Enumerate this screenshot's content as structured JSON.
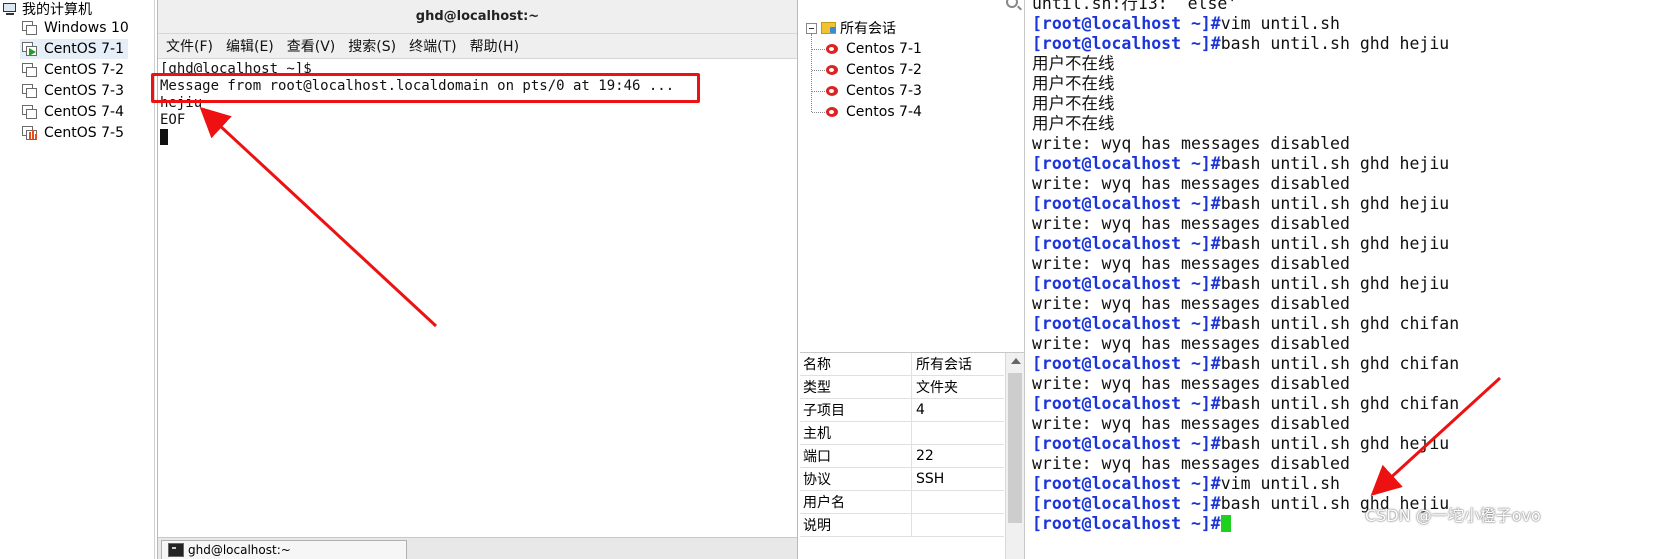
{
  "vm_tree": {
    "root_label": "我的计算机",
    "items": [
      {
        "label": "Windows 10",
        "state": "off"
      },
      {
        "label": "CentOS 7-1",
        "state": "running"
      },
      {
        "label": "CentOS 7-2",
        "state": "off"
      },
      {
        "label": "CentOS 7-3",
        "state": "off"
      },
      {
        "label": "CentOS 7-4",
        "state": "off"
      },
      {
        "label": "CentOS 7-5",
        "state": "suspended"
      }
    ]
  },
  "console": {
    "title": "ghd@localhost:~",
    "menu": [
      "文件(F)",
      "编辑(E)",
      "查看(V)",
      "搜索(S)",
      "终端(T)",
      "帮助(H)"
    ],
    "lines": [
      "[ghd@localhost ~]$",
      "Message from root@localhost.localdomain on pts/0 at 19:46 ...",
      "hejiu",
      "EOF"
    ],
    "taskbar_item": "ghd@localhost:~"
  },
  "sessions": {
    "root_label": "所有会话",
    "items": [
      "Centos 7-1",
      "Centos 7-2",
      "Centos 7-3",
      "Centos 7-4"
    ],
    "properties": [
      {
        "key": "名称",
        "value": "所有会话"
      },
      {
        "key": "类型",
        "value": "文件夹"
      },
      {
        "key": "子项目",
        "value": "4"
      },
      {
        "key": "主机",
        "value": ""
      },
      {
        "key": "端口",
        "value": "22"
      },
      {
        "key": "协议",
        "value": "SSH"
      },
      {
        "key": "用户名",
        "value": ""
      },
      {
        "key": "说明",
        "value": ""
      }
    ]
  },
  "shell": {
    "prompt": "[root@localhost ~]#",
    "lines": [
      {
        "prompt": false,
        "text": "until.sh:行13:  else'"
      },
      {
        "prompt": true,
        "text": "vim until.sh"
      },
      {
        "prompt": true,
        "text": "bash until.sh ghd hejiu"
      },
      {
        "prompt": false,
        "text": "用户不在线"
      },
      {
        "prompt": false,
        "text": "用户不在线"
      },
      {
        "prompt": false,
        "text": "用户不在线"
      },
      {
        "prompt": false,
        "text": "用户不在线"
      },
      {
        "prompt": false,
        "text": "write: wyq has messages disabled"
      },
      {
        "prompt": true,
        "text": "bash until.sh ghd hejiu"
      },
      {
        "prompt": false,
        "text": "write: wyq has messages disabled"
      },
      {
        "prompt": true,
        "text": "bash until.sh ghd hejiu"
      },
      {
        "prompt": false,
        "text": "write: wyq has messages disabled"
      },
      {
        "prompt": true,
        "text": "bash until.sh ghd hejiu"
      },
      {
        "prompt": false,
        "text": "write: wyq has messages disabled"
      },
      {
        "prompt": true,
        "text": "bash until.sh ghd hejiu"
      },
      {
        "prompt": false,
        "text": "write: wyq has messages disabled"
      },
      {
        "prompt": true,
        "text": "bash until.sh ghd chifan"
      },
      {
        "prompt": false,
        "text": "write: wyq has messages disabled"
      },
      {
        "prompt": true,
        "text": "bash until.sh ghd chifan"
      },
      {
        "prompt": false,
        "text": "write: wyq has messages disabled"
      },
      {
        "prompt": true,
        "text": "bash until.sh ghd chifan"
      },
      {
        "prompt": false,
        "text": "write: wyq has messages disabled"
      },
      {
        "prompt": true,
        "text": "bash until.sh ghd hejiu"
      },
      {
        "prompt": false,
        "text": "write: wyq has messages disabled"
      },
      {
        "prompt": true,
        "text": "vim until.sh"
      },
      {
        "prompt": true,
        "text": "bash until.sh ghd hejiu"
      },
      {
        "prompt": true,
        "text": ""
      }
    ]
  },
  "watermark": "CSDN @一坨小橙子ovo",
  "colors": {
    "prompt": "#1c35d8",
    "cursor": "#1fd11f",
    "annotation": "#ee1111"
  }
}
